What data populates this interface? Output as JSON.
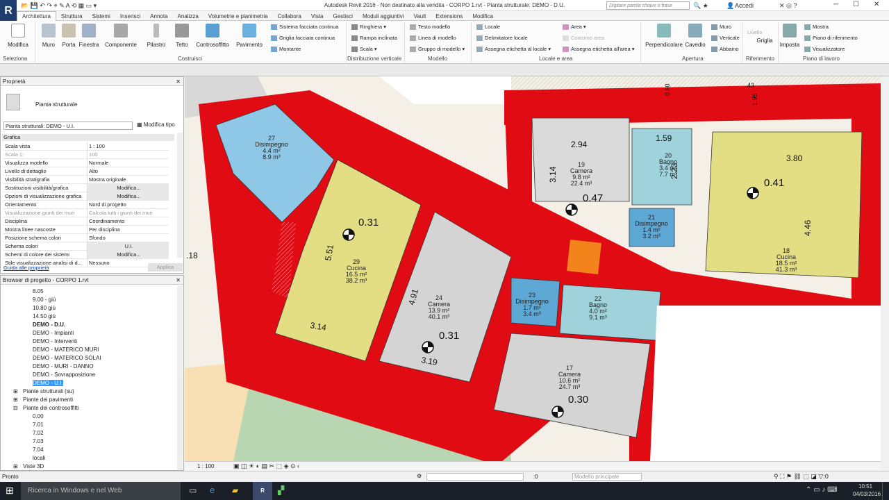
{
  "app": {
    "title": "Autodesk Revit 2016 -  Non destinato alla vendita -    CORPO 1.rvt - Pianta strutturale: DEMO - D.U.",
    "search_placeholder": "Digitare parola chiave o frase",
    "sign_in": "Accedi",
    "logo_letter": "R"
  },
  "tabs": [
    "Architettura",
    "Struttura",
    "Sistemi",
    "Inserisci",
    "Annota",
    "Analizza",
    "Volumetrie e planimetria",
    "Collabora",
    "Vista",
    "Gestisci",
    "Moduli aggiuntivi",
    "Vault",
    "Extensions",
    "Modifica"
  ],
  "ribbon": {
    "big_buttons": [
      {
        "label": "Modifica",
        "icon": "cursor-icon"
      },
      {
        "label": "Muro",
        "icon": "wall-icon"
      },
      {
        "label": "Porta",
        "icon": "door-icon"
      },
      {
        "label": "Finestra",
        "icon": "window-icon"
      },
      {
        "label": "Componente",
        "icon": "component-icon"
      },
      {
        "label": "Pilastro",
        "icon": "column-icon"
      },
      {
        "label": "Tetto",
        "icon": "roof-icon"
      },
      {
        "label": "Controsoffitto",
        "icon": "ceiling-icon"
      },
      {
        "label": "Pavimento",
        "icon": "floor-icon"
      },
      {
        "label": "Perpendicolare",
        "icon": "perpendicular-icon"
      },
      {
        "label": "Cavedio",
        "icon": "shaft-icon"
      },
      {
        "label": "Griglia",
        "icon": "grid-icon"
      },
      {
        "label": "Imposta",
        "icon": "set-icon"
      }
    ],
    "small_buttons": {
      "costruisci": [
        "Sistema facciata continua",
        "Griglia facciata continua",
        "Montante"
      ],
      "distribuzione": [
        "Ringhiera",
        "Rampa inclinata",
        "Scala"
      ],
      "modello": [
        "Testo modello",
        "Linea di modello",
        "Gruppo di modello"
      ],
      "locale": [
        "Locale",
        "Delimitatore locale",
        "Assegna etichetta  al locale"
      ],
      "area": [
        "Area",
        "Contorno area",
        "Assegna etichetta  all'area"
      ],
      "apertura": [
        "Muro",
        "Verticale",
        "Abbaino"
      ],
      "riferimento": [
        "Livello"
      ],
      "piano": [
        "Mostra",
        "Piano di riferimento",
        "Visualizzatore"
      ]
    },
    "panels": [
      "Seleziona",
      "Costruisci",
      "Distribuzione verticale",
      "Modello",
      "Locale e area",
      "Apertura",
      "Riferimento",
      "Piano di lavoro"
    ]
  },
  "properties": {
    "header": "Proprietà",
    "type_name": "Pianta strutturale",
    "instance": "Pianta strutturali: DEMO - U.I.",
    "edit_type": "Modifica tipo",
    "group": "Grafica",
    "rows": [
      {
        "k": "Scala vista",
        "v": "1 : 100"
      },
      {
        "k": "Scala  1:",
        "v": "100"
      },
      {
        "k": "Visualizza modello",
        "v": "Normale"
      },
      {
        "k": "Livello di dettaglio",
        "v": "Alto"
      },
      {
        "k": "Visibilità stratigrafia",
        "v": "Mostra originale"
      },
      {
        "k": "Sostituzioni visibilità/grafica",
        "v": "Modifica..."
      },
      {
        "k": "Opzioni di visualizzazione grafica",
        "v": "Modifica..."
      },
      {
        "k": "Orientamento",
        "v": "Nord di progetto"
      },
      {
        "k": "Visualizzazione giunti dei muri",
        "v": "Calcola tutti i giunti dei muri"
      },
      {
        "k": "Disciplina",
        "v": "Coordinamento"
      },
      {
        "k": "Mostra linee nascoste",
        "v": "Per disciplina"
      },
      {
        "k": "Posizione schema colori",
        "v": "Sfondo"
      },
      {
        "k": "Schema colori",
        "v": "U.I."
      },
      {
        "k": "Schemi di colore dei sistemi",
        "v": "Modifica..."
      },
      {
        "k": "Stile visualizzazione analisi di d...",
        "v": "Nessuno"
      }
    ],
    "help_link": "Guida alle proprietà",
    "apply": "Applica"
  },
  "browser": {
    "header": "Browser di progetto - CORPO 1.rvt",
    "items": [
      "8.05",
      "9.00 - giù",
      "10.80 giù",
      "14.50 giù",
      "DEMO - D.U.",
      "DEMO - Impianti",
      "DEMO - Interventi",
      "DEMO - MATERICO MURI",
      "DEMO - MATERICO SOLAI",
      "DEMO - MURI - DANNO",
      "DEMO - Sovrapposizione",
      "DEMO - U.I.",
      "Piante strutturali (su)",
      "Piante dei pavimenti",
      "Piante dei controsoffitti",
      "0.00",
      "7.01",
      "7.02",
      "7.03",
      "7.04",
      "locali",
      "Viste 3D"
    ]
  },
  "rooms": [
    {
      "num": "27",
      "name": "Disimpegno",
      "a": "4.4 m²",
      "b": "8.9 m³"
    },
    {
      "num": "29",
      "name": "Cucina",
      "a": "16.5 m²",
      "b": "38.2 m³"
    },
    {
      "num": "24",
      "name": "Camera",
      "a": "13.9 m²",
      "b": "40.1 m³"
    },
    {
      "num": "19",
      "name": "Camera",
      "a": "9.8 m²",
      "b": "22.4 m³"
    },
    {
      "num": "20",
      "name": "Bagno",
      "a": "3.4 m²",
      "b": "7.7 m³"
    },
    {
      "num": "21",
      "name": "Disimpegno",
      "a": "1.4 m²",
      "b": "3.2 m³"
    },
    {
      "num": "18",
      "name": "Cucina",
      "a": "18.5 m²",
      "b": "41.3 m³"
    },
    {
      "num": "23",
      "name": "Disimpegno",
      "a": "1.7 m²",
      "b": "3.4 m³"
    },
    {
      "num": "22",
      "name": "Bagno",
      "a": "4.0 m²",
      "b": "9.1 m³"
    },
    {
      "num": "17",
      "name": "Camera",
      "a": "10.6 m²",
      "b": "24.7 m³"
    }
  ],
  "dims": [
    "2.94",
    "1.59",
    "3.80",
    "3.14",
    "2.23",
    "4.46",
    "5.51",
    "4.91",
    "3.14",
    "3.19",
    ".18",
    "0.60",
    "1.95",
    "43"
  ],
  "levels": [
    "0.31",
    "0.31",
    "0.47",
    "0.41",
    "0.30"
  ],
  "view_scale": "1 : 100",
  "status": {
    "left": "Pronto",
    "coord": ":0",
    "model": "Modello principale"
  },
  "taskbar": {
    "search": "Ricerca in Windows e nel Web",
    "time": "10:51",
    "date": "04/03/2016"
  }
}
